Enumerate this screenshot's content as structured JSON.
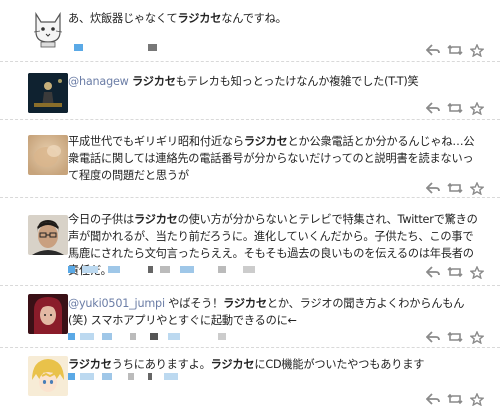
{
  "tweets": [
    {
      "avatar_icon": "cat-avatar-icon",
      "handle": "",
      "segments": [
        "あ、炊飯器じゃなくて",
        "ラジカセ",
        "なんですね。"
      ]
    },
    {
      "avatar_icon": "person-stage-avatar-icon",
      "handle": "@hanagew",
      "segments": [
        " ",
        "ラジカセ",
        "もテレカも知っとったけなんか複雑でした(T-T)笑"
      ]
    },
    {
      "avatar_icon": "blurred-photo-avatar-icon",
      "handle": "",
      "segments": [
        "平成世代でもギリギリ昭和付近なら",
        "ラジカセ",
        "とか公衆電話とか分かるんじゃね…公衆電話に関しては連絡先の電話番号が分からないだけってのと説明書を読まないって程度の問題だと思うが"
      ]
    },
    {
      "avatar_icon": "person-glasses-avatar-icon",
      "handle": "",
      "segments": [
        "今日の子供は",
        "ラジカセ",
        "の使い方が分からないとテレビで特集され、Twitterで驚きの声が聞かれるが、当たり前だろうに。進化していくんだから。子供たち、この事で馬鹿にされたら文句言ったらええ。そもそも過去の良いものを伝えるのは年長者の責任だ。"
      ]
    },
    {
      "avatar_icon": "person-red-hair-avatar-icon",
      "handle": "@yuki0501_jumpi",
      "segments": [
        " やばそう！",
        "ラジカセ",
        "とか、ラジオの聞き方よくわからんもん(笑) スマホアプリやとすぐに起動できるのに←"
      ]
    },
    {
      "avatar_icon": "anime-blonde-avatar-icon",
      "handle": "",
      "segments": [
        "",
        "ラジカセ",
        "うちにありますよ。",
        "ラジカセ",
        "にCD機能がついたやつもあります"
      ]
    }
  ]
}
